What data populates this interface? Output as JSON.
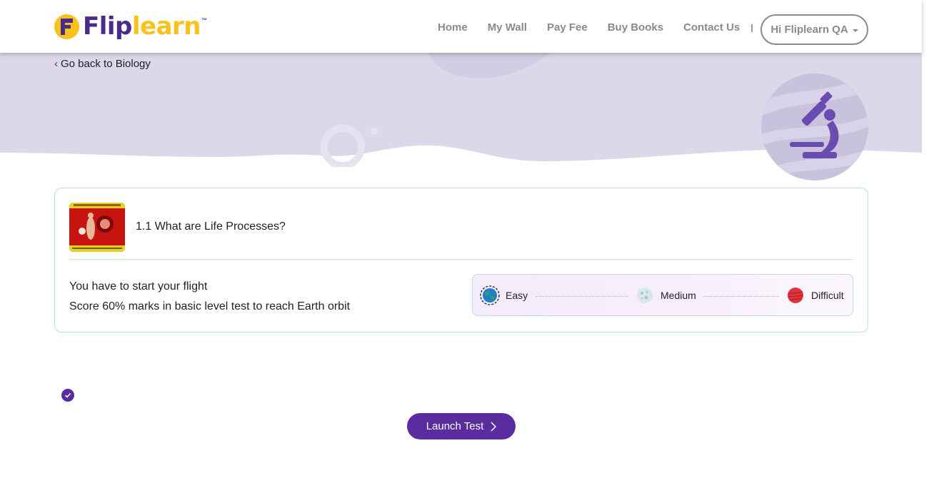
{
  "header": {
    "logo": {
      "part1": "Flip",
      "part2": "learn",
      "tm": "™",
      "badge_letter": "F"
    },
    "nav": [
      {
        "label": "Home"
      },
      {
        "label": "My Wall"
      },
      {
        "label": "Pay Fee"
      },
      {
        "label": "Buy Books"
      },
      {
        "label": "Contact Us"
      }
    ],
    "user_menu": {
      "label": "Hi Fliplearn QA"
    }
  },
  "banner": {
    "back_link": "Go back to Biology",
    "subject_icon": "microscope-icon"
  },
  "card": {
    "lesson_title": "1.1 What are Life Processes?",
    "message_line1": "You have to start your flight",
    "message_line2": "Score 60% marks in basic level test to reach Earth orbit",
    "levels": [
      {
        "label": "Easy",
        "icon": "earth-planet-icon"
      },
      {
        "label": "Medium",
        "icon": "moon-planet-icon"
      },
      {
        "label": "Difficult",
        "icon": "mars-planet-icon"
      }
    ]
  },
  "actions": {
    "launch_label": "Launch Test"
  },
  "colors": {
    "brand_purple": "#5b2ca0",
    "brand_yellow": "#f6c21b",
    "banner_bg": "#dcd8ea"
  }
}
